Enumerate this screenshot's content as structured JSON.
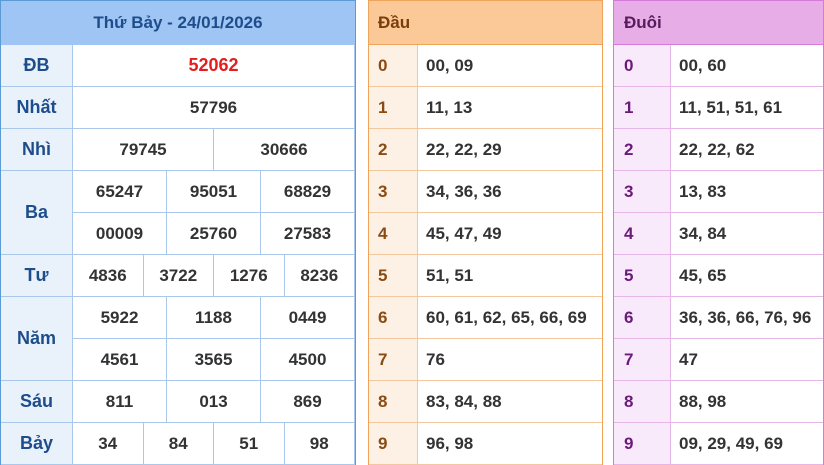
{
  "results": {
    "title": "Thứ Bảy - 24/01/2026",
    "prizes": [
      {
        "label": "ĐB",
        "key": "db",
        "values": [
          "52062"
        ]
      },
      {
        "label": "Nhất",
        "key": "nhat",
        "values": [
          "57796"
        ]
      },
      {
        "label": "Nhì",
        "key": "nhi",
        "values": [
          "79745",
          "30666"
        ]
      },
      {
        "label": "Ba",
        "key": "ba",
        "values": [
          "65247",
          "95051",
          "68829",
          "00009",
          "25760",
          "27583"
        ]
      },
      {
        "label": "Tư",
        "key": "tu",
        "values": [
          "4836",
          "3722",
          "1276",
          "8236"
        ]
      },
      {
        "label": "Năm",
        "key": "nam",
        "values": [
          "5922",
          "1188",
          "0449",
          "4561",
          "3565",
          "4500"
        ]
      },
      {
        "label": "Sáu",
        "key": "sau",
        "values": [
          "811",
          "013",
          "869"
        ]
      },
      {
        "label": "Bảy",
        "key": "bay",
        "values": [
          "34",
          "84",
          "51",
          "98"
        ]
      }
    ]
  },
  "head_table": {
    "header": "Đầu",
    "rows": [
      {
        "digit": "0",
        "values": "00, 09"
      },
      {
        "digit": "1",
        "values": "11, 13"
      },
      {
        "digit": "2",
        "values": "22, 22, 29"
      },
      {
        "digit": "3",
        "values": "34, 36, 36"
      },
      {
        "digit": "4",
        "values": "45, 47, 49"
      },
      {
        "digit": "5",
        "values": "51, 51"
      },
      {
        "digit": "6",
        "values": "60, 61, 62, 65, 66, 69"
      },
      {
        "digit": "7",
        "values": "76"
      },
      {
        "digit": "8",
        "values": "83, 84, 88"
      },
      {
        "digit": "9",
        "values": "96, 98"
      }
    ]
  },
  "tail_table": {
    "header": "Đuôi",
    "rows": [
      {
        "digit": "0",
        "values": "00, 60"
      },
      {
        "digit": "1",
        "values": "11, 51, 51, 61"
      },
      {
        "digit": "2",
        "values": "22, 22, 62"
      },
      {
        "digit": "3",
        "values": "13, 83"
      },
      {
        "digit": "4",
        "values": "34, 84"
      },
      {
        "digit": "5",
        "values": "45, 65"
      },
      {
        "digit": "6",
        "values": "36, 36, 66, 76, 96"
      },
      {
        "digit": "7",
        "values": "47"
      },
      {
        "digit": "8",
        "values": "88, 98"
      },
      {
        "digit": "9",
        "values": "09, 29, 49, 69"
      }
    ]
  },
  "colors": {
    "special_prize": "#e41e1e",
    "results_border": "#5b9bd5",
    "head_border": "#f0a45a",
    "tail_border": "#d67ad9"
  }
}
